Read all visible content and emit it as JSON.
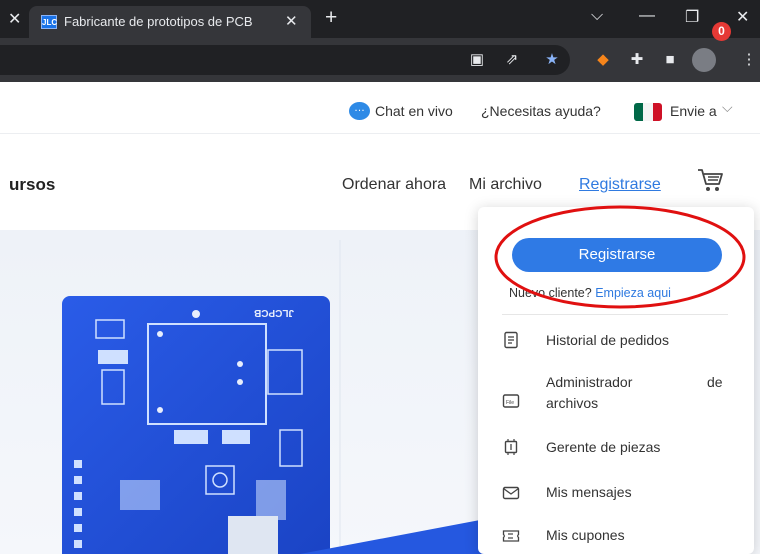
{
  "browser": {
    "tab_title": "Fabricante de prototipos de PCB",
    "tab_favicon": "JLC",
    "icons": [
      "translate-icon",
      "share-icon",
      "bookmark-star-icon",
      "metamask-icon",
      "extensions-icon",
      "sidebar-icon",
      "profile-avatar-icon",
      "menu-icon"
    ]
  },
  "utilbar": {
    "chat_label": "Chat en vivo",
    "help_label": "¿Necesitas ayuda?",
    "ship_to_label": "Envie a"
  },
  "nav": {
    "brand_fragment": "ursos",
    "order_now": "Ordenar ahora",
    "my_files": "Mi archivo",
    "register": "Registrarse",
    "cart_count": "0"
  },
  "dropdown": {
    "register_button": "Registrarse",
    "new_client_text": "Nuevo cliente?",
    "new_client_link": "Empieza aqui",
    "items": [
      {
        "label": "Historial de pedidos",
        "icon": "order-history-icon"
      },
      {
        "label_line1": "Administrador",
        "label_line1b": "de",
        "label_line2": "archivos",
        "icon": "file-manager-icon"
      },
      {
        "label": "Gerente de piezas",
        "icon": "chip-icon"
      },
      {
        "label": "Mis mensajes",
        "icon": "envelope-icon"
      },
      {
        "label": "Mis cupones",
        "icon": "coupon-icon"
      }
    ]
  },
  "hero": {
    "pcb_brand": "JLCPCB"
  },
  "colors": {
    "accent": "#2f7ae5",
    "annotation": "#e01010",
    "badge": "#e53935",
    "pcb": "#1f4fd6"
  }
}
